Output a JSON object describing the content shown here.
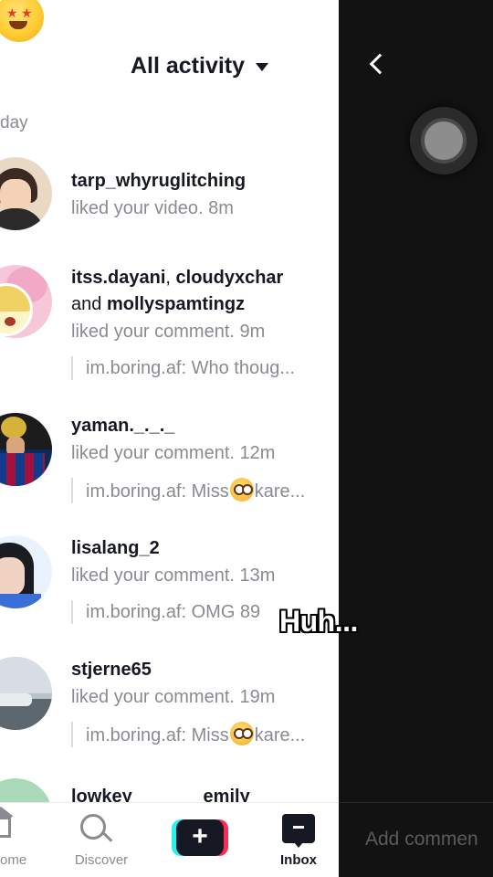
{
  "header": {
    "title": "All activity"
  },
  "section": {
    "label": "day"
  },
  "items": [
    {
      "user_line": "tarp_whyruglitching",
      "activity": "liked your video.",
      "time": "8m"
    },
    {
      "user_a": "itss.dayani",
      "sep": ", ",
      "user_b": "cloudyxchar",
      "and": "and ",
      "user_c": "mollyspamtingz",
      "activity": "liked your comment.",
      "time": "9m",
      "quote": "im.boring.af: Who thoug..."
    },
    {
      "user_line": "yaman._._._",
      "activity": "liked your comment.",
      "time": "12m",
      "quote_pre": "im.boring.af: Miss",
      "quote_post": "kare..."
    },
    {
      "user_line": "lisalang_2",
      "activity": "liked your comment.",
      "time": "13m",
      "quote": "im.boring.af: OMG 89"
    },
    {
      "user_line": "stjerne65",
      "activity": "liked your comment.",
      "time": "19m",
      "quote_pre": "im.boring.af: Miss",
      "quote_post": "kare..."
    },
    {
      "user_line": "lowkey_______emily"
    }
  ],
  "nav": {
    "home": "ome",
    "discover": "Discover",
    "create": "+",
    "inbox": "Inbox"
  },
  "comment": {
    "placeholder": "Add commen"
  },
  "caption": "Huh..."
}
